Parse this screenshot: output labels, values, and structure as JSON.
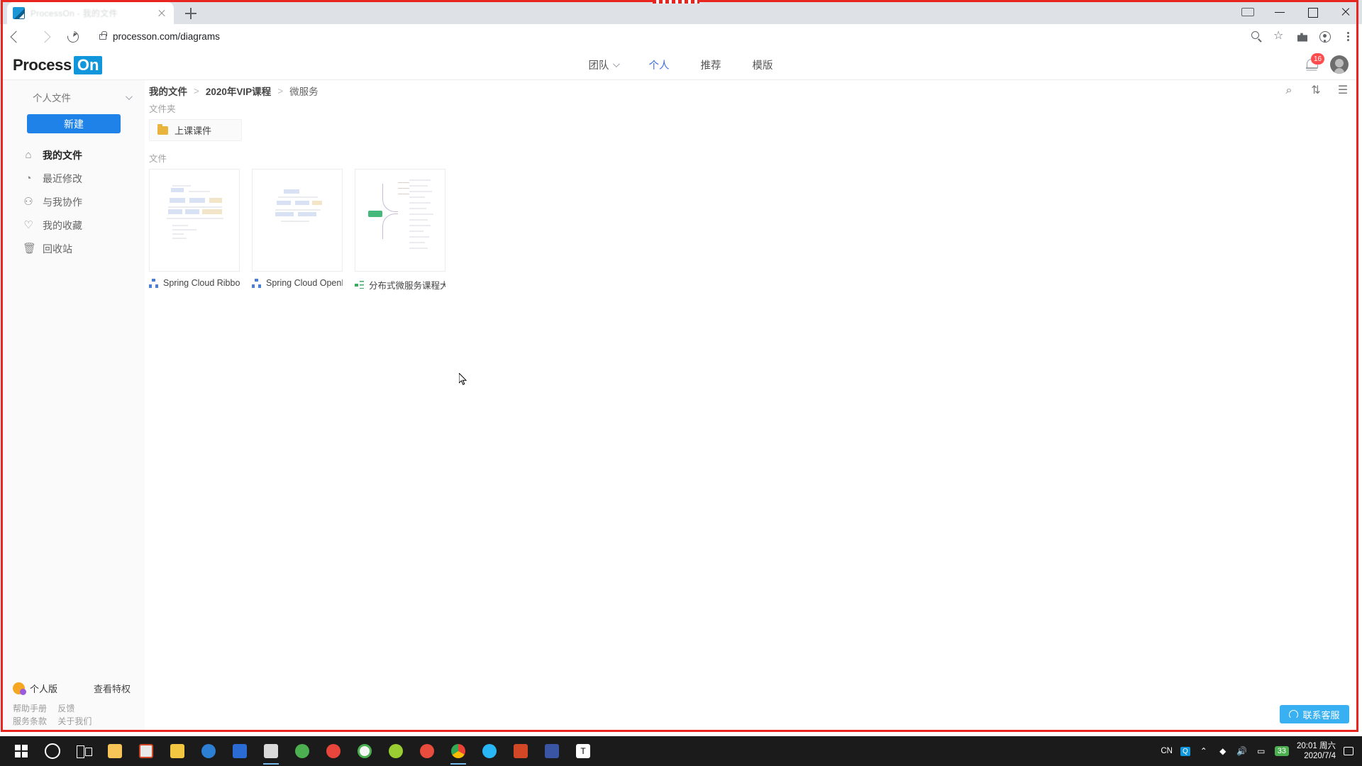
{
  "browser": {
    "tab_title": "ProcessOn - 我的文件",
    "url": "processon.com/diagrams",
    "new_tab_label": "+",
    "icons": {
      "back": "back-arrow-icon",
      "forward": "forward-arrow-icon",
      "reload": "reload-icon",
      "lock": "lock-icon",
      "search": "search-icon",
      "bookmark": "star-icon",
      "extensions": "puzzle-icon",
      "profile": "profile-icon",
      "menu": "kebab-menu-icon",
      "cast": "cast-icon",
      "minimize": "minimize-icon",
      "maximize": "maximize-icon",
      "close": "close-icon"
    }
  },
  "app": {
    "logo": {
      "part1": "Process",
      "part2": "On"
    },
    "nav": [
      {
        "label": "团队",
        "has_chevron": true,
        "active": false
      },
      {
        "label": "个人",
        "has_chevron": false,
        "active": true
      },
      {
        "label": "推荐",
        "has_chevron": false,
        "active": false
      },
      {
        "label": "模版",
        "has_chevron": false,
        "active": false
      }
    ],
    "notification_count": "16"
  },
  "sidebar": {
    "space_selector": "个人文件",
    "new_button": "新建",
    "items": [
      {
        "label": "我的文件",
        "icon": "home-icon",
        "glyph": "⌂",
        "active": true
      },
      {
        "label": "最近修改",
        "icon": "clock-icon",
        "glyph": "◔",
        "active": false
      },
      {
        "label": "与我协作",
        "icon": "users-icon",
        "glyph": "⚇",
        "active": false
      },
      {
        "label": "我的收藏",
        "icon": "heart-icon",
        "glyph": "♡",
        "active": false
      },
      {
        "label": "回收站",
        "icon": "trash-icon",
        "glyph": "🗑",
        "active": false
      }
    ],
    "footer": {
      "plan": "个人版",
      "privileges_link": "查看特权",
      "links": [
        "帮助手册",
        "反馈",
        "服务条款",
        "关于我们"
      ]
    }
  },
  "content": {
    "breadcrumb": [
      {
        "label": "我的文件",
        "bold": true
      },
      {
        "label": "2020年VIP课程",
        "bold": true
      },
      {
        "label": "微服务",
        "bold": false
      }
    ],
    "breadcrumb_separator": ">",
    "toolbar": [
      {
        "icon": "search-icon",
        "glyph": "⌕"
      },
      {
        "icon": "sort-icon",
        "glyph": "⇅"
      },
      {
        "icon": "list-view-icon",
        "glyph": "☰"
      }
    ],
    "folder_section_label": "文件夹",
    "folders": [
      {
        "name": "上课课件",
        "icon": "folder-icon"
      }
    ],
    "file_section_label": "文件",
    "files": [
      {
        "name": "Spring Cloud Ribbon...",
        "type": "flowchart",
        "icon": "flowchart-icon"
      },
      {
        "name": "Spring Cloud OpenFei...",
        "type": "flowchart",
        "icon": "flowchart-icon"
      },
      {
        "name": "分布式微服务课程大纲...",
        "type": "mindmap",
        "icon": "mindmap-icon"
      }
    ]
  },
  "service_button": {
    "label": "联系客服",
    "icon": "headset-icon"
  },
  "taskbar": {
    "time": "20:01 周六",
    "date": "2020/7/4",
    "ime": "CN",
    "temperature": "33",
    "icons": [
      "windows-start-icon",
      "search-icon",
      "task-view-icon",
      "file-explorer-icon",
      "photos-icon",
      "sticky-notes-icon",
      "edge-icon",
      "store-icon",
      "app-icon",
      "grass-icon",
      "opera-icon",
      "chrome-alt-icon",
      "cloud-icon",
      "spinner-icon",
      "chrome-icon",
      "telegram-icon",
      "powerpoint-icon",
      "visio-icon",
      "typora-icon"
    ]
  },
  "colors": {
    "accent": "#1e82e8",
    "nav_active": "#3b6fe0",
    "badge": "#ff4d4f",
    "service": "#39b0f1",
    "annotation": "#e8251f"
  }
}
